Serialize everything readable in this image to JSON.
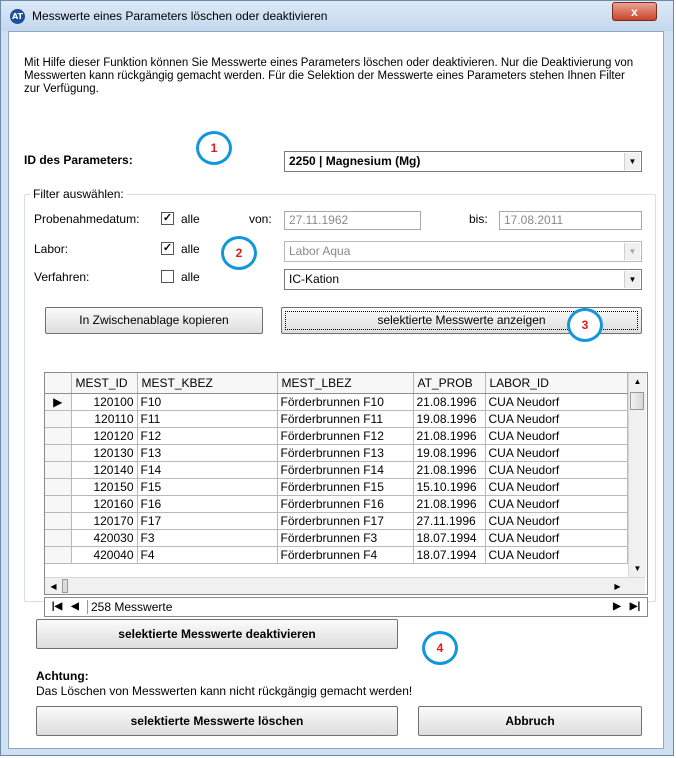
{
  "window": {
    "title": "Messwerte eines Parameters löschen oder deaktivieren",
    "app_icon": "AT",
    "close": "x"
  },
  "description": "Mit Hilfe dieser Funktion können Sie Messwerte eines Parameters löschen oder deaktivieren. Nur die Deaktivierung von Messwerten kann rückgängig gemacht werden. Für die Selektion der Messwerte eines Parameters stehen Ihnen Filter zur Verfügung.",
  "parameter": {
    "label": "ID des Parameters:",
    "value": "2250 | Magnesium (Mg)"
  },
  "filter": {
    "title": "Filter auswählen:",
    "probenahme_label": "Probenahmedatum:",
    "probenahme_alle_checked": true,
    "alle_label": "alle",
    "von_label": "von:",
    "von_value": "27.11.1962",
    "bis_label": "bis:",
    "bis_value": "17.08.2011",
    "labor_label": "Labor:",
    "labor_alle_checked": true,
    "labor_value": "Labor Aqua",
    "verfahren_label": "Verfahren:",
    "verfahren_alle_checked": false,
    "verfahren_value": "IC-Kation"
  },
  "buttons": {
    "copy": "In Zwischenablage kopieren",
    "show": "selektierte Messwerte anzeigen",
    "deactivate": "selektierte Messwerte deaktivieren",
    "delete": "selektierte Messwerte löschen",
    "cancel": "Abbruch"
  },
  "markers": [
    "1",
    "2",
    "3",
    "4"
  ],
  "grid": {
    "columns": [
      "MEST_ID",
      "MEST_KBEZ",
      "MEST_LBEZ",
      "AT_PROB",
      "LABOR_ID"
    ],
    "rows": [
      [
        "120100",
        "F10",
        "Förderbrunnen F10",
        "21.08.1996",
        "CUA Neudorf"
      ],
      [
        "120110",
        "F11",
        "Förderbrunnen F11",
        "19.08.1996",
        "CUA Neudorf"
      ],
      [
        "120120",
        "F12",
        "Förderbrunnen F12",
        "21.08.1996",
        "CUA Neudorf"
      ],
      [
        "120130",
        "F13",
        "Förderbrunnen F13",
        "19.08.1996",
        "CUA Neudorf"
      ],
      [
        "120140",
        "F14",
        "Förderbrunnen F14",
        "21.08.1996",
        "CUA Neudorf"
      ],
      [
        "120150",
        "F15",
        "Förderbrunnen F15",
        "15.10.1996",
        "CUA Neudorf"
      ],
      [
        "120160",
        "F16",
        "Förderbrunnen F16",
        "21.08.1996",
        "CUA Neudorf"
      ],
      [
        "120170",
        "F17",
        "Förderbrunnen F17",
        "27.11.1996",
        "CUA Neudorf"
      ],
      [
        "420030",
        "F3",
        "Förderbrunnen F3",
        "18.07.1994",
        "CUA Neudorf"
      ],
      [
        "420040",
        "F4",
        "Förderbrunnen F4",
        "18.07.1994",
        "CUA Neudorf"
      ]
    ],
    "current_row_indicator": "▶"
  },
  "navigator": {
    "count_text": "258 Messwerte"
  },
  "warning": {
    "title": "Achtung:",
    "text": "Das Löschen von Messwerten kann nicht rückgängig gemacht werden!"
  },
  "icons": {
    "dropdown": "dropdown-arrow-icon",
    "check": "checkmark-icon",
    "first": "first-record-icon",
    "prev": "previous-record-icon",
    "next": "next-record-icon",
    "last": "last-record-icon"
  }
}
